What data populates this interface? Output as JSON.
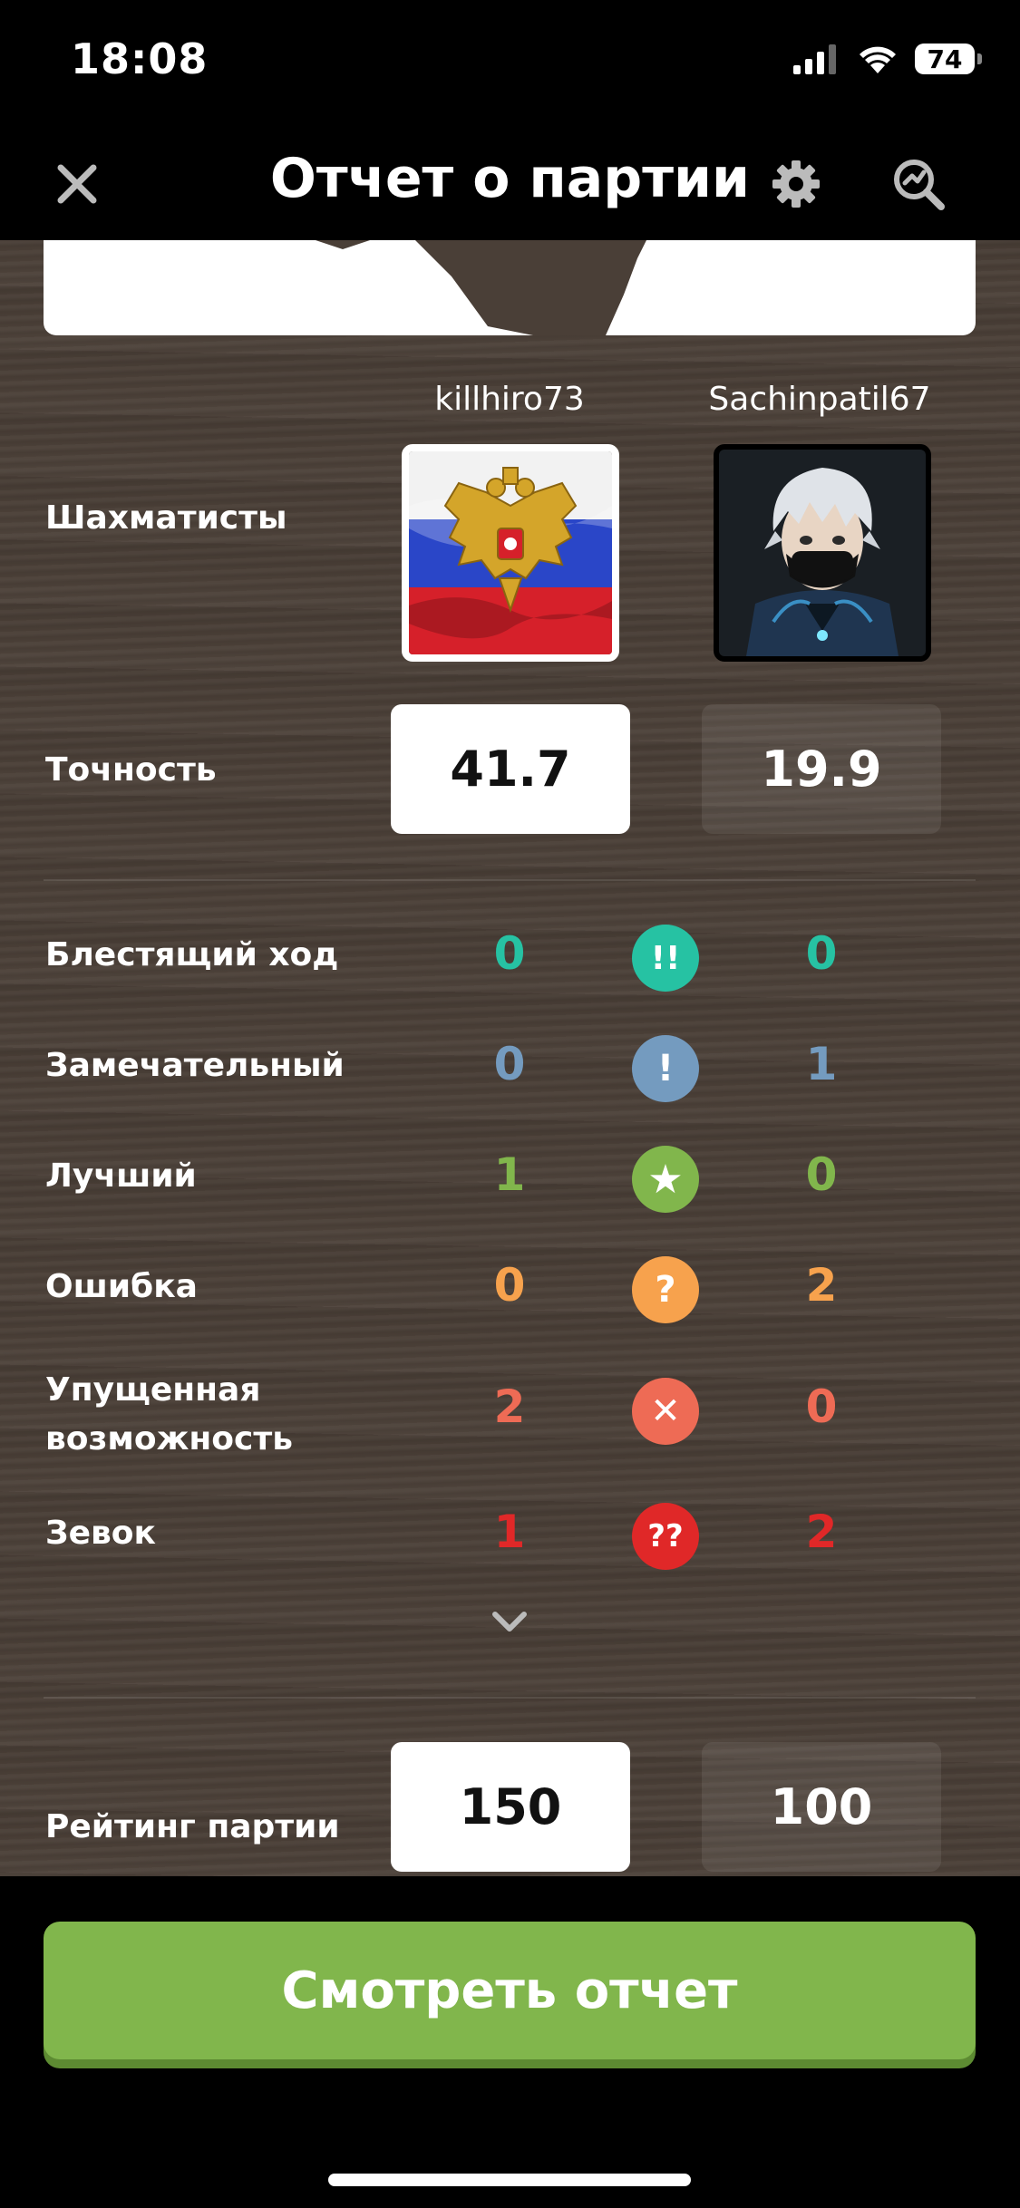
{
  "status": {
    "time": "18:08",
    "battery": "74"
  },
  "header": {
    "title": "Отчет о партии"
  },
  "players": {
    "label": "Шахматисты",
    "white": {
      "name": "killhiro73"
    },
    "black": {
      "name": "Sachinpatil67"
    }
  },
  "accuracy": {
    "label": "Точность",
    "white": "41.7",
    "black": "19.9"
  },
  "moves": [
    {
      "label": "Блестящий ход",
      "white": "0",
      "black": "0",
      "symbol": "!!",
      "color": "#26c2a3",
      "icon": "brilliant-icon"
    },
    {
      "label": "Замечательный",
      "white": "0",
      "black": "1",
      "symbol": "!",
      "color": "#749bbf",
      "icon": "great-icon"
    },
    {
      "label": "Лучший",
      "white": "1",
      "black": "0",
      "symbol": "★",
      "color": "#81b64c",
      "icon": "best-star-icon"
    },
    {
      "label": "Ошибка",
      "white": "0",
      "black": "2",
      "symbol": "?",
      "color": "#f7a24d",
      "icon": "mistake-icon"
    },
    {
      "label": "Упущенная возможность",
      "white": "2",
      "black": "0",
      "symbol": "✕",
      "color": "#ee6b55",
      "icon": "miss-icon"
    },
    {
      "label": "Зевок",
      "white": "1",
      "black": "2",
      "symbol": "??",
      "color": "#e02828",
      "icon": "blunder-icon"
    }
  ],
  "rating": {
    "label": "Рейтинг партии",
    "white": "150",
    "black": "100"
  },
  "footer": {
    "button": "Смотреть отчет"
  }
}
